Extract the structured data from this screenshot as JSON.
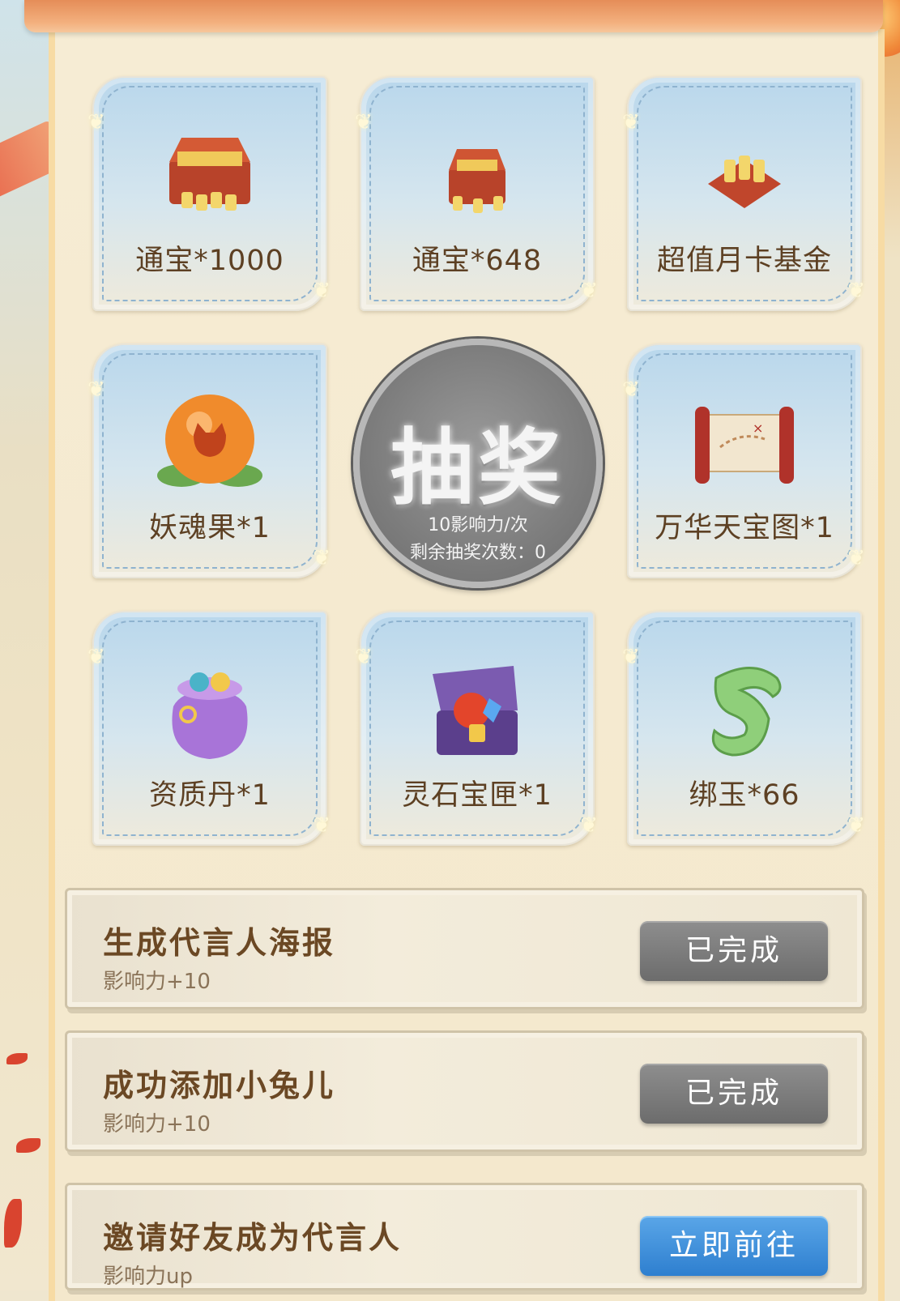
{
  "prizes": [
    {
      "label": "通宝*1000",
      "icon": "treasure-chest-large-icon"
    },
    {
      "label": "通宝*648",
      "icon": "treasure-chest-small-icon"
    },
    {
      "label": "超值月卡基金",
      "icon": "coin-bundle-icon"
    },
    {
      "label": "妖魂果*1",
      "icon": "orb-fruit-icon"
    },
    {
      "label": "万华天宝图*1",
      "icon": "scroll-map-icon"
    },
    {
      "label": "资质丹*1",
      "icon": "pouch-icon"
    },
    {
      "label": "灵石宝匣*1",
      "icon": "gem-chest-icon"
    },
    {
      "label": "绑玉*66",
      "icon": "jade-icon"
    }
  ],
  "draw": {
    "label": "抽奖",
    "cost": "10影响力/次",
    "remaining": "剩余抽奖次数：0"
  },
  "tasks": [
    {
      "title": "生成代言人海报",
      "reward": "影响力+10",
      "button": "已完成",
      "status": "done"
    },
    {
      "title": "成功添加小兔儿",
      "reward": "影响力+10",
      "button": "已完成",
      "status": "done"
    },
    {
      "title": "邀请好友成为代言人",
      "reward": "影响力up",
      "button": "立即前往",
      "status": "go"
    }
  ],
  "colors": {
    "done_button": "#7a7a7a",
    "go_button": "#3c8fdb",
    "label_text": "#5d4023"
  }
}
